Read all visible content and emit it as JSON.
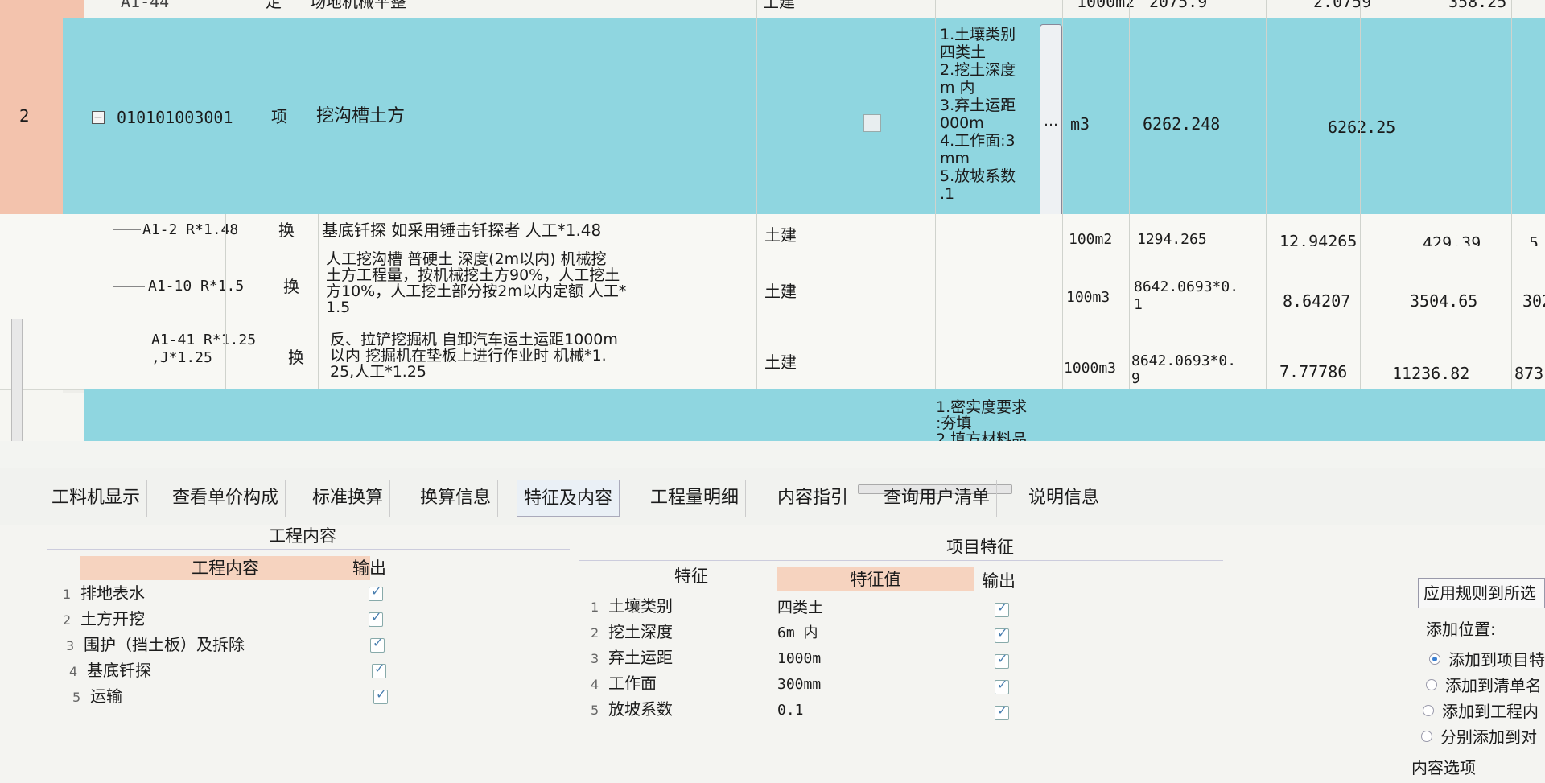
{
  "grid": {
    "top_row": {
      "code": "A1-44",
      "type": "定",
      "name": "场地机械平整",
      "discipline": "土建",
      "unit": "1000m2",
      "qty_expr": "2075.9",
      "qty": "2.0759",
      "price": "358.25"
    },
    "main_row": {
      "seq": "2",
      "code": "010101003001",
      "type": "项",
      "name": "挖沟槽土方",
      "features": [
        "1.土壤类别",
        "四类土",
        "2.挖土深度",
        "m 内",
        "3.弃土运距",
        "000m",
        "4.工作面:3",
        "mm",
        "5.放坡系数",
        ".1"
      ],
      "ellipsis": "…",
      "unit": "m3",
      "qty_expr": "6262.248",
      "qty": "6262.25"
    },
    "sub_rows": [
      {
        "code": "A1-2 R*1.48",
        "type": "换",
        "name_lines": [
          "基底钎探 如采用锤击钎探者 人工*1.48"
        ],
        "discipline": "土建",
        "unit": "100m2",
        "qty_expr": "1294.265",
        "qty": "12.94265",
        "price": "429.39",
        "total": "5"
      },
      {
        "code": "A1-10 R*1.5",
        "type": "换",
        "name_lines": [
          "人工挖沟槽 普硬土 深度(2m以内) 机械挖",
          "土方工程量，按机械挖土方90%，人工挖土",
          "方10%，人工挖土部分按2m以内定额 人工*",
          "1.5"
        ],
        "discipline": "土建",
        "unit": "100m3",
        "qty_expr_lines": [
          "8642.0693*0.",
          "1"
        ],
        "qty": "8.64207",
        "price": "3504.65",
        "total": "302"
      },
      {
        "code_lines": [
          "A1-41 R*1.25",
          ",J*1.25"
        ],
        "type": "换",
        "name_lines": [
          "反、拉铲挖掘机 自卸汽车运土运距1000m",
          "以内 挖掘机在垫板上进行作业时 机械*1.",
          "25,人工*1.25"
        ],
        "discipline": "土建",
        "unit": "1000m3",
        "qty_expr_lines": [
          "8642.0693*0.",
          "9"
        ],
        "qty": "7.77786",
        "price": "11236.82",
        "total": "873"
      }
    ],
    "next_row_features": [
      "1.密实度要求",
      ":夯填",
      "2.填方材料品"
    ]
  },
  "tabs": [
    "工料机显示",
    "查看单价构成",
    "标准换算",
    "换算信息",
    "特征及内容",
    "工程量明细",
    "内容指引",
    "查询用户清单",
    "说明信息"
  ],
  "active_tab": "特征及内容",
  "work_content": {
    "title": "工程内容",
    "col_content": "工程内容",
    "col_output": "输出",
    "items": [
      {
        "no": "1",
        "text": "排地表水"
      },
      {
        "no": "2",
        "text": "土方开挖"
      },
      {
        "no": "3",
        "text": "围护（挡土板）及拆除"
      },
      {
        "no": "4",
        "text": "基底钎探"
      },
      {
        "no": "5",
        "text": "运输"
      }
    ]
  },
  "features": {
    "title": "项目特征",
    "col_feature": "特征",
    "col_value": "特征值",
    "col_output": "输出",
    "items": [
      {
        "no": "1",
        "name": "土壤类别",
        "value": "四类土"
      },
      {
        "no": "2",
        "name": "挖土深度",
        "value": "6m 内"
      },
      {
        "no": "3",
        "name": "弃土运距",
        "value": "1000m"
      },
      {
        "no": "4",
        "name": "工作面",
        "value": "300mm"
      },
      {
        "no": "5",
        "name": "放坡系数",
        "value": "0.1"
      }
    ]
  },
  "right_panel": {
    "apply_button": "应用规则到所选",
    "position_label": "添加位置:",
    "options": [
      "添加到项目特",
      "添加到清单名",
      "添加到工程内",
      "分别添加到对"
    ],
    "selected_option": 0,
    "content_options_label": "内容选项"
  }
}
